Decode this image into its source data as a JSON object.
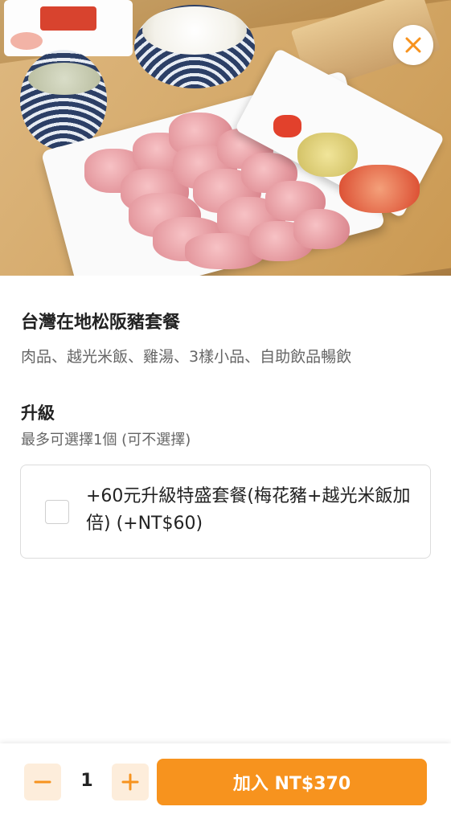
{
  "header": {
    "close_icon": "close-icon"
  },
  "item": {
    "title": "台灣在地松阪豬套餐",
    "description": "肉品、越光米飯、雞湯、3樣小品、自助飲品暢飲"
  },
  "options_group": {
    "title": "升級",
    "subtitle": "最多可選擇1個 (可不選擇)",
    "options": [
      {
        "label": "+60元升級特盛套餐(梅花豬+越光米飯加倍) (+NT$60)",
        "checked": false
      }
    ]
  },
  "footer": {
    "quantity": "1",
    "minus_icon": "minus-icon",
    "plus_icon": "plus-icon",
    "add_button_label": "加入 NT$370"
  },
  "colors": {
    "accent": "#f7931e",
    "accent_light": "#fdeddb",
    "text_primary": "#222222",
    "text_secondary": "#666666",
    "border": "#dcdcdc"
  }
}
